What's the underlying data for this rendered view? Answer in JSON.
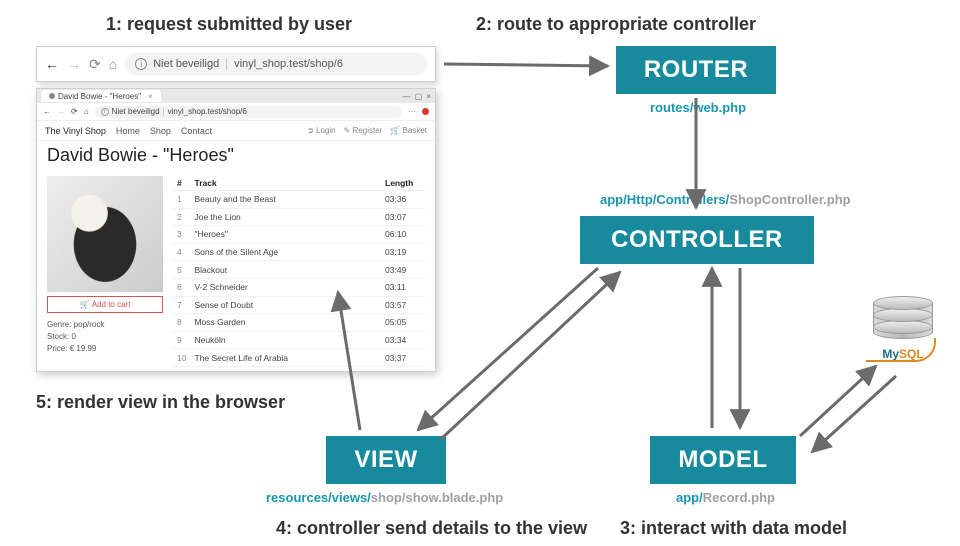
{
  "steps": {
    "s1": "1: request submitted by user",
    "s2": "2: route to appropriate controller",
    "s3": "3: interact with data model",
    "s4": "4: controller send details to the view",
    "s5": "5: render view in the browser"
  },
  "boxes": {
    "router": "ROUTER",
    "controller": "CONTROLLER",
    "view": "VIEW",
    "model": "MODEL"
  },
  "paths": {
    "router_teal": "routes/web.php",
    "controller_teal": "app/Http/Controllers/",
    "controller_grey": "ShopController.php",
    "view_teal": "resources/views/",
    "view_grey": "shop/show.blade.php",
    "model_teal": "app/",
    "model_grey": "Record.php"
  },
  "db_label": {
    "my": "My",
    "sql": "SQL"
  },
  "address_bar": {
    "not_secure": "Niet beveiligd",
    "url": "vinyl_shop.test/shop/6"
  },
  "browser": {
    "tab_title": "David Bowie - \"Heroes\"",
    "nav": {
      "brand": "The Vinyl Shop",
      "links": [
        "Home",
        "Shop",
        "Contact"
      ],
      "login": "Login",
      "register": "Register",
      "basket": "Basket"
    },
    "page_title": "David Bowie - \"Heroes\"",
    "add_to_cart": "Add to cart",
    "meta": {
      "genre_label": "Genre:",
      "genre": "pop/rock",
      "stock_label": "Stock:",
      "stock": "0",
      "price_label": "Price:",
      "price": "€ 19.99"
    },
    "columns": {
      "num": "#",
      "track": "Track",
      "length": "Length"
    },
    "tracks": [
      {
        "n": "1",
        "title": "Beauty and the Beast",
        "len": "03:36"
      },
      {
        "n": "2",
        "title": "Joe the Lion",
        "len": "03:07"
      },
      {
        "n": "3",
        "title": "\"Heroes\"",
        "len": "06:10"
      },
      {
        "n": "4",
        "title": "Sons of the Silent Age",
        "len": "03:19"
      },
      {
        "n": "5",
        "title": "Blackout",
        "len": "03:49"
      },
      {
        "n": "6",
        "title": "V-2 Schneider",
        "len": "03:11"
      },
      {
        "n": "7",
        "title": "Sense of Doubt",
        "len": "03:57"
      },
      {
        "n": "8",
        "title": "Moss Garden",
        "len": "05:05"
      },
      {
        "n": "9",
        "title": "Neuköln",
        "len": "03:34"
      },
      {
        "n": "10",
        "title": "The Secret Life of Arabia",
        "len": "03:37"
      }
    ]
  }
}
